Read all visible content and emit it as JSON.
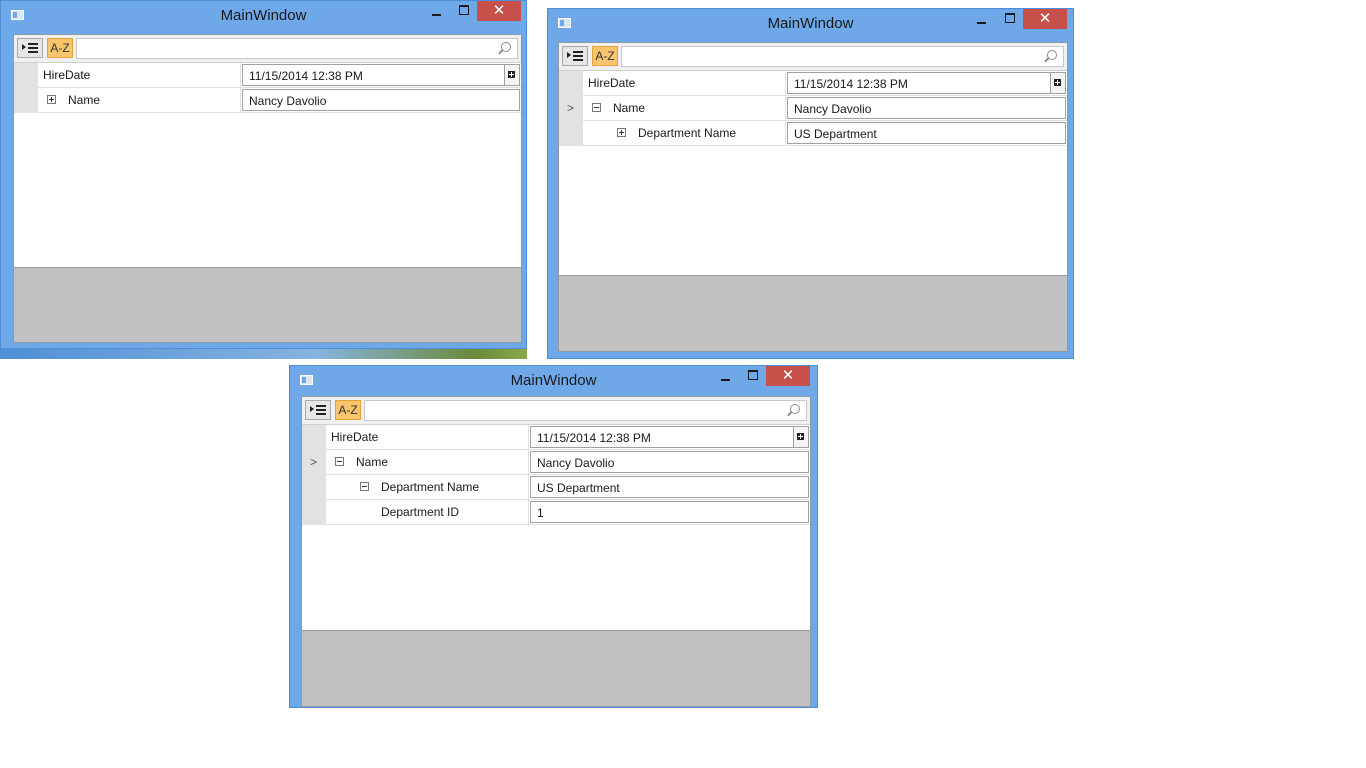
{
  "window_title": "MainWindow",
  "controls": {
    "minimize": "–",
    "maximize": "□",
    "close": "✕"
  },
  "toolbar": {
    "az_label": "A-Z",
    "search_placeholder": ""
  },
  "windows": [
    {
      "rows": [
        {
          "label": "HireDate",
          "value": "11/15/2014 12:38 PM"
        },
        {
          "label": "Name",
          "value": "Nancy Davolio",
          "expander": "plus"
        }
      ]
    },
    {
      "rows": [
        {
          "label": "HireDate",
          "value": "11/15/2014 12:38 PM"
        },
        {
          "label": "Name",
          "value": "Nancy Davolio",
          "expander": "minus"
        },
        {
          "label": "Department Name",
          "value": "US Department",
          "expander": "plus"
        }
      ]
    },
    {
      "rows": [
        {
          "label": "HireDate",
          "value": "11/15/2014 12:38 PM"
        },
        {
          "label": "Name",
          "value": "Nancy Davolio",
          "expander": "minus"
        },
        {
          "label": "Department Name",
          "value": "US Department",
          "expander": "minus"
        },
        {
          "label": "Department ID",
          "value": "1"
        }
      ]
    }
  ],
  "colors": {
    "titlebar": "#6fa8e8",
    "close_button": "#c7504a",
    "az_button": "#f8c56d",
    "description_pane": "#c2c2c2"
  },
  "icons": [
    "app-icon",
    "minimize-icon",
    "maximize-icon",
    "close-icon",
    "categorize-icon",
    "search-icon",
    "expand-icon",
    "collapse-icon",
    "calendar-icon",
    "chevron-right-icon"
  ]
}
